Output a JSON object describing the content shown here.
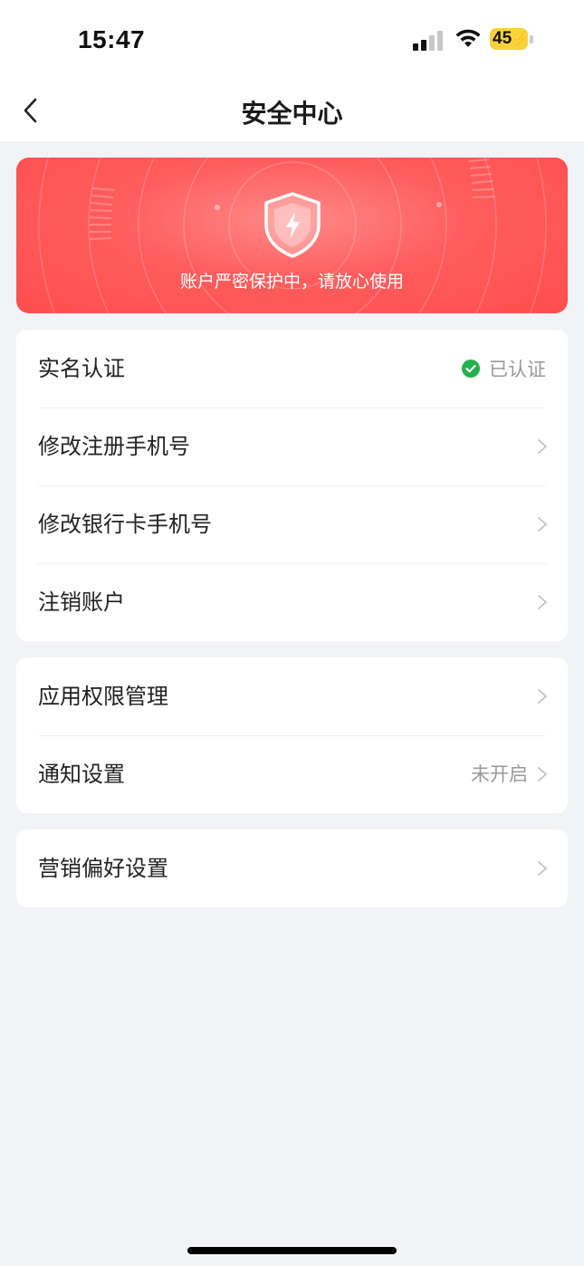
{
  "status_bar": {
    "time": "15:47",
    "battery": "45"
  },
  "nav": {
    "title": "安全中心"
  },
  "banner": {
    "text": "账户严密保护中，请放心使用"
  },
  "account_group": {
    "items": [
      {
        "label": "实名认证",
        "status": "已认证"
      },
      {
        "label": "修改注册手机号"
      },
      {
        "label": "修改银行卡手机号"
      },
      {
        "label": "注销账户"
      }
    ]
  },
  "permission_group": {
    "items": [
      {
        "label": "应用权限管理"
      },
      {
        "label": "通知设置",
        "value": "未开启"
      }
    ]
  },
  "marketing_group": {
    "items": [
      {
        "label": "营销偏好设置"
      }
    ]
  },
  "colors": {
    "accent": "#ff4d4f",
    "verified": "#22b14c",
    "background": "#f2f3f7"
  }
}
